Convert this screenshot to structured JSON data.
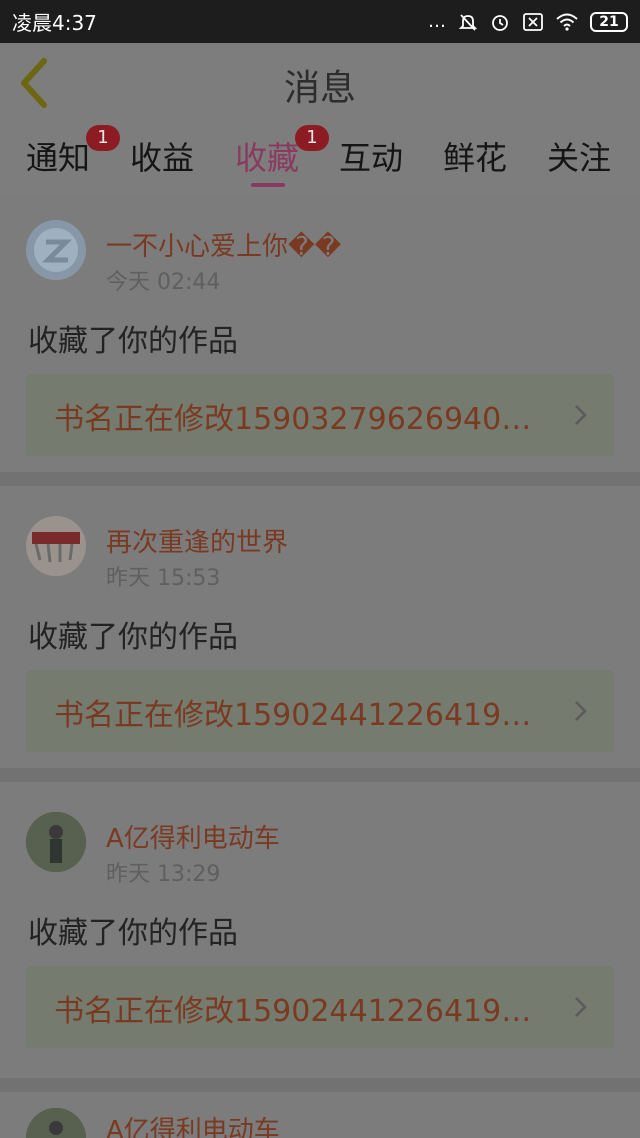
{
  "status_bar": {
    "time": "凌晨4:37",
    "dots": "…",
    "battery": "21"
  },
  "header": {
    "title": "消息"
  },
  "tabs": [
    {
      "label": "通知",
      "badge": "1"
    },
    {
      "label": "收益",
      "badge": ""
    },
    {
      "label": "收藏",
      "badge": "1",
      "active": true
    },
    {
      "label": "互动",
      "badge": ""
    },
    {
      "label": "鲜花",
      "badge": ""
    },
    {
      "label": "关注",
      "badge": ""
    }
  ],
  "messages": [
    {
      "user": "一不小心爱上你��",
      "time": "今天 02:44",
      "action": "收藏了你的作品",
      "book": "书名正在修改15903279626940…"
    },
    {
      "user": "再次重逢的世界",
      "time": "昨天 15:53",
      "action": "收藏了你的作品",
      "book": "书名正在修改15902441226419…"
    },
    {
      "user": "A亿得利电动车",
      "time": "昨天 13:29",
      "action": "收藏了你的作品",
      "book": "书名正在修改15902441226419…"
    },
    {
      "user": "A亿得利电动车"
    }
  ],
  "colors": {
    "accent": "#8a3a60",
    "link_orange": "#7a3a22",
    "badge_red": "#8c1b23"
  }
}
